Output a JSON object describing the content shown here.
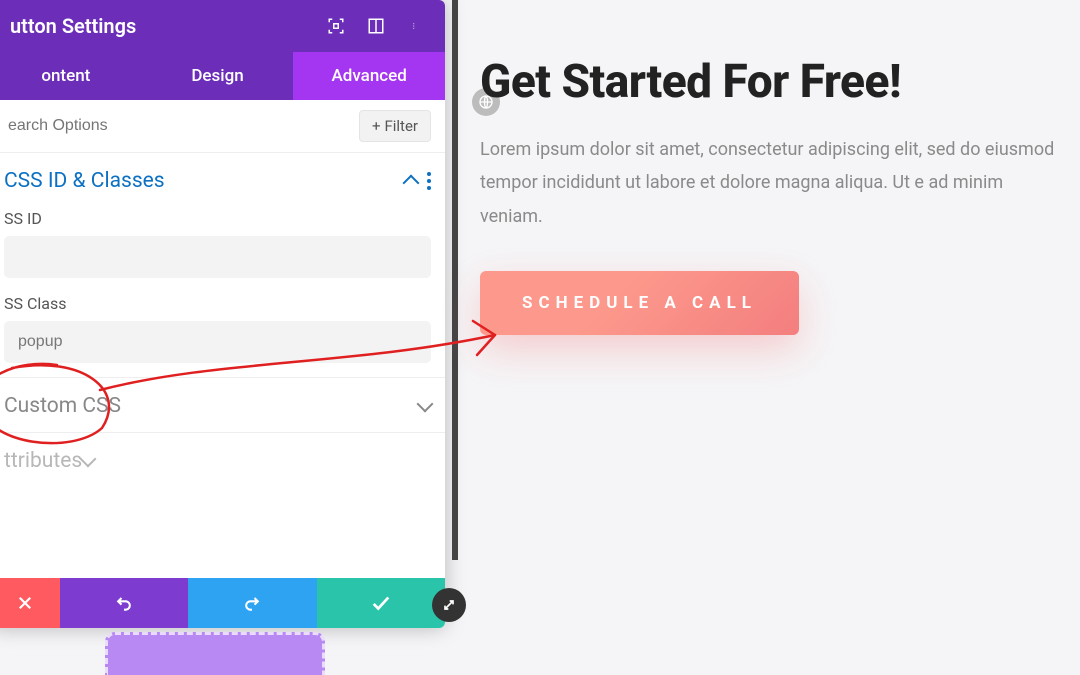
{
  "panel": {
    "title": "utton Settings",
    "tabs": {
      "content": "ontent",
      "design": "Design",
      "advanced": "Advanced"
    },
    "search_placeholder": "earch Options",
    "filter_label": "Filter"
  },
  "sections": {
    "css_id_classes": {
      "title": "CSS ID & Classes",
      "css_id_label": "SS ID",
      "css_id_value": "",
      "css_class_label": "SS Class",
      "css_class_value": "popup"
    },
    "custom_css": {
      "title": "Custom CSS"
    },
    "attributes": {
      "title": "ttributes"
    }
  },
  "page": {
    "headline": "Get Started For Free!",
    "body": "Lorem ipsum dolor sit amet, consectetur adipiscing elit, sed do eiusmod tempor incididunt ut labore et dolore magna aliqua. Ut e ad minim veniam.",
    "cta": "SCHEDULE A CALL"
  },
  "colors": {
    "accent_purple": "#6c2eb9",
    "accent_purple_light": "#a435f0",
    "link_blue": "#0c71c3",
    "cta_start": "#ff8a7a",
    "cta_end": "#f36a6a"
  }
}
